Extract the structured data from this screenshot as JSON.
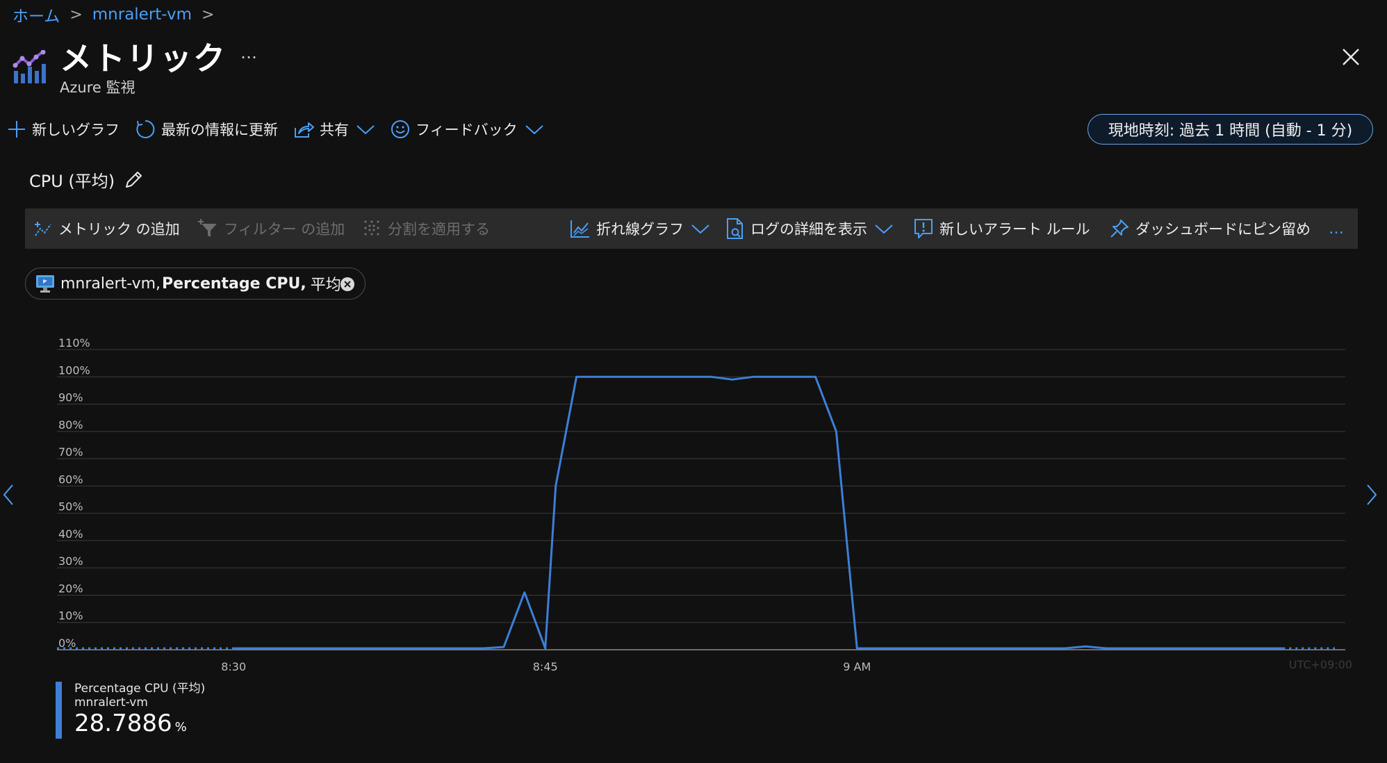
{
  "breadcrumb": {
    "home": "ホーム",
    "resource": "mnralert-vm"
  },
  "header": {
    "title": "メトリック",
    "more": "…",
    "subtitle": "Azure 監視"
  },
  "commands": {
    "new_chart": "新しいグラフ",
    "refresh": "最新の情報に更新",
    "share": "共有",
    "feedback": "フィードバック",
    "time_range": "現地時刻: 過去 1 時間 (自動 - 1 分)"
  },
  "chart_title": "CPU (平均)",
  "chart_toolbar": {
    "add_metric": "メトリック の追加",
    "add_filter": "フィルター の追加",
    "apply_splitting": "分割を適用する",
    "line_chart": "折れ線グラフ",
    "view_logs": "ログの詳細を表示",
    "new_alert": "新しいアラート ルール",
    "pin_dashboard": "ダッシュボードにピン留め",
    "more": "…"
  },
  "metric_pill": {
    "resource": "mnralert-vm,",
    "metric": "Percentage CPU,",
    "aggregation": "平均"
  },
  "legend": {
    "name": "Percentage CPU (平均)",
    "resource": "mnralert-vm",
    "value": "28.7886",
    "unit": "%"
  },
  "colors": {
    "accent": "#4aa0f5",
    "series": "#3d7fd6",
    "background": "#111112"
  },
  "chart_data": {
    "type": "line",
    "title": "CPU (平均)",
    "xlabel": "",
    "ylabel": "",
    "y_ticks": [
      "0%",
      "10%",
      "20%",
      "30%",
      "40%",
      "50%",
      "60%",
      "70%",
      "80%",
      "90%",
      "100%",
      "110%"
    ],
    "ylim": [
      0,
      110
    ],
    "x_ticks": [
      {
        "label": "8:30",
        "t": 30
      },
      {
        "label": "8:45",
        "t": 45
      },
      {
        "label": "9 AM",
        "t": 60
      }
    ],
    "timezone": "UTC+09:00",
    "x_domain_minutes_past_8": [
      21.5,
      83.5
    ],
    "dotted_segments": [
      [
        21.5,
        30
      ],
      [
        80.5,
        83
      ]
    ],
    "series": [
      {
        "name": "Percentage CPU (平均)",
        "color": "#3d7fd6",
        "points": [
          [
            30,
            0.5
          ],
          [
            32,
            0.5
          ],
          [
            35,
            0.5
          ],
          [
            38,
            0.5
          ],
          [
            42,
            0.5
          ],
          [
            43,
            1.0
          ],
          [
            44,
            21
          ],
          [
            45,
            0.5
          ],
          [
            45.5,
            60
          ],
          [
            46.5,
            100
          ],
          [
            48,
            100
          ],
          [
            50,
            100
          ],
          [
            53,
            100
          ],
          [
            54,
            99
          ],
          [
            55,
            100
          ],
          [
            58,
            100
          ],
          [
            59,
            80
          ],
          [
            60,
            0.5
          ],
          [
            65,
            0.5
          ],
          [
            70,
            0.5
          ],
          [
            71,
            1.2
          ],
          [
            72,
            0.5
          ],
          [
            75,
            0.5
          ],
          [
            80.5,
            0.5
          ]
        ]
      }
    ]
  }
}
